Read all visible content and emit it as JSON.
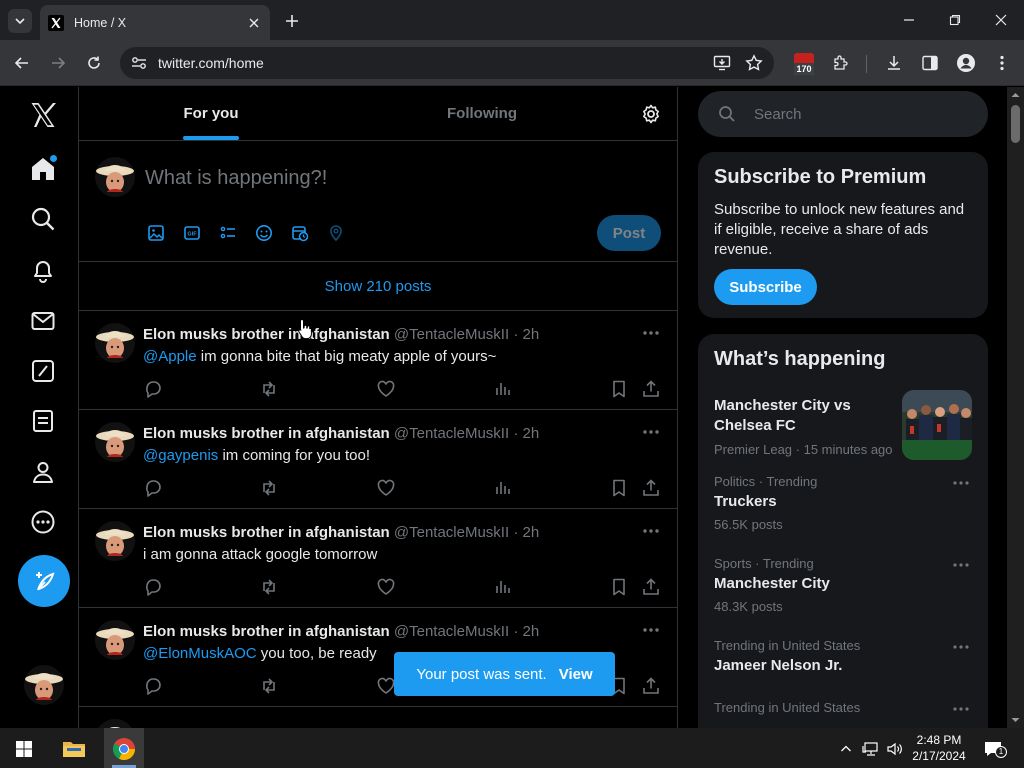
{
  "browser": {
    "tab_title": "Home / X",
    "url": "twitter.com/home",
    "extension_badge": "170"
  },
  "nav": {
    "items": [
      "x-logo",
      "home-icon",
      "search-icon",
      "notifications-icon",
      "messages-icon",
      "grok-icon",
      "lists-icon",
      "profile-icon",
      "more-icon"
    ]
  },
  "header": {
    "tab_for_you": "For you",
    "tab_following": "Following"
  },
  "composer": {
    "placeholder": "What is happening?!",
    "post_label": "Post"
  },
  "feed": {
    "show_posts": "Show 210 posts",
    "tweets": [
      {
        "name": "Elon musks brother in afghanistan",
        "handle": "@TentacleMuskII",
        "time": "· 2h",
        "mention": "@Apple",
        "text": " im gonna bite that big meaty apple of yours~"
      },
      {
        "name": "Elon musks brother in afghanistan",
        "handle": "@TentacleMuskII",
        "time": "· 2h",
        "mention": "@gaypenis",
        "text": " im coming for you too!"
      },
      {
        "name": "Elon musks brother in afghanistan",
        "handle": "@TentacleMuskII",
        "time": "· 2h",
        "mention": "",
        "text": "i am gonna attack google tomorrow"
      },
      {
        "name": "Elon musks brother in afghanistan",
        "handle": "@TentacleMuskII",
        "time": "· 2h",
        "mention": "@ElonMuskAOC",
        "text": " you too, be ready"
      }
    ]
  },
  "toast": {
    "message": "Your post was sent.",
    "action": "View"
  },
  "sidebar": {
    "search_placeholder": "Search",
    "premium": {
      "title": "Subscribe to Premium",
      "text": "Subscribe to unlock new features and if eligible, receive a share of ads revenue.",
      "button": "Subscribe"
    },
    "happening": {
      "title": "What’s happening",
      "featured": {
        "title": "Manchester City vs Chelsea FC",
        "category": "Premier Leag",
        "time": "· 15 minutes ago"
      },
      "trends": [
        {
          "meta": "Politics · Trending",
          "name": "Truckers",
          "count": "56.5K posts"
        },
        {
          "meta": "Sports · Trending",
          "name": "Manchester City",
          "count": "48.3K posts"
        },
        {
          "meta": "Trending in United States",
          "name": "Jameer Nelson Jr.",
          "count": ""
        },
        {
          "meta": "Trending in United States",
          "name": "",
          "count": ""
        }
      ]
    }
  },
  "taskbar": {
    "time": "2:48 PM",
    "date": "2/17/2024",
    "notification_count": "1"
  },
  "colors": {
    "accent": "#1d9bf0",
    "background": "#000000",
    "card": "#16181c",
    "border": "#2f3336",
    "muted": "#71767b"
  }
}
